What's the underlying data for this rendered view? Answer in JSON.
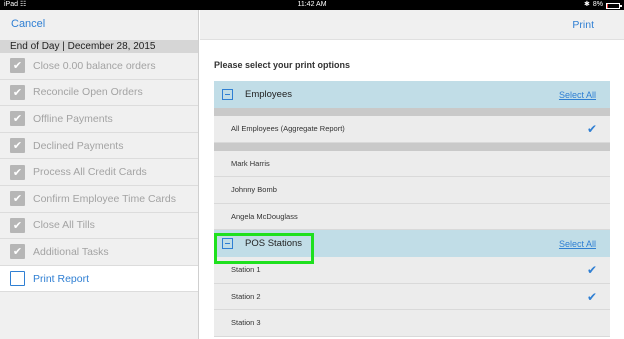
{
  "status_bar": {
    "device": "iPad",
    "wifi_icon": "wifi-icon",
    "time": "11:42 AM",
    "battery_text": "8%",
    "battery_level": 0.08
  },
  "left_panel": {
    "cancel": "Cancel",
    "heading": "End of Day | December 28, 2015",
    "tasks": [
      {
        "label": "Close 0.00 balance orders",
        "checked": true
      },
      {
        "label": "Reconcile Open Orders",
        "checked": true
      },
      {
        "label": "Offline Payments",
        "checked": true
      },
      {
        "label": "Declined Payments",
        "checked": true
      },
      {
        "label": "Process All Credit Cards",
        "checked": true
      },
      {
        "label": "Confirm Employee Time Cards",
        "checked": true
      },
      {
        "label": "Close All Tills",
        "checked": true
      },
      {
        "label": "Additional Tasks",
        "checked": true
      },
      {
        "label": "Print Report",
        "checked": false
      }
    ]
  },
  "right_panel": {
    "print_button": "Print",
    "prompt": "Please select your print options",
    "sections": [
      {
        "title": "Employees",
        "select_all": "Select All",
        "aggregate": {
          "label": "All Employees (Aggregate Report)",
          "selected": true
        },
        "items": [
          {
            "label": "Mark Harris",
            "selected": false
          },
          {
            "label": "Johnny Bomb",
            "selected": false
          },
          {
            "label": "Angela McDouglass",
            "selected": false
          }
        ]
      },
      {
        "title": "POS Stations",
        "select_all": "Select All",
        "items": [
          {
            "label": "Station 1",
            "selected": true
          },
          {
            "label": "Station 2",
            "selected": true
          },
          {
            "label": "Station 3",
            "selected": false
          }
        ]
      }
    ]
  },
  "colors": {
    "accent": "#2f7fd3",
    "section_bg": "#c1dde7",
    "highlight": "#1ee01e"
  }
}
